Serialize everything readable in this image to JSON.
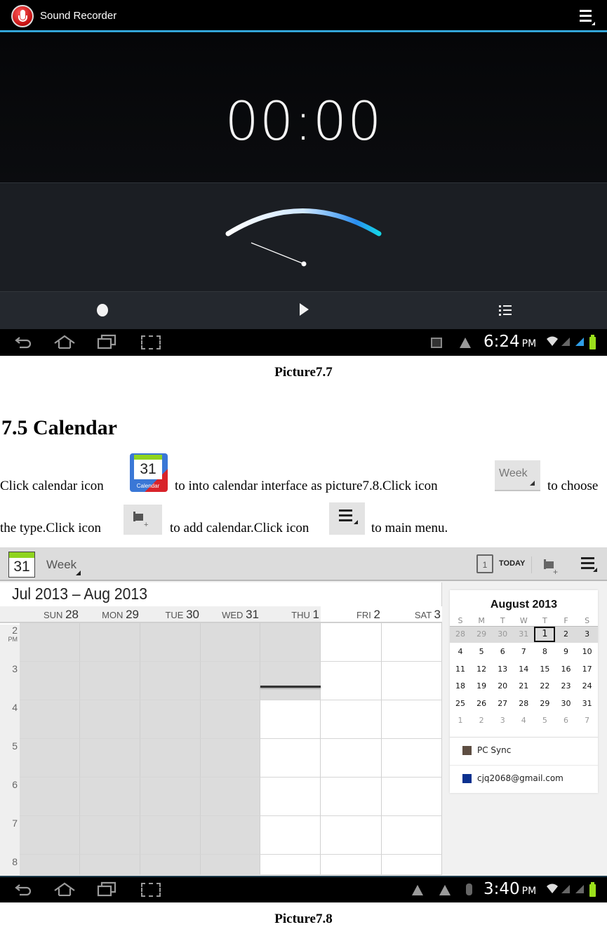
{
  "sound_recorder": {
    "app_title": "Sound Recorder",
    "timer": "00:00",
    "level_meter_value": 0,
    "controls": [
      {
        "name": "record",
        "icon": "record-icon"
      },
      {
        "name": "play",
        "icon": "play-icon"
      },
      {
        "name": "recordings-list",
        "icon": "list-icon"
      }
    ],
    "status_bar": {
      "time": "6:24",
      "ampm": "PM",
      "icons": [
        "gallery-notification-icon",
        "warning-icon",
        "wifi-icon",
        "signal-icon",
        "signal-icon",
        "battery-icon"
      ]
    }
  },
  "document": {
    "caption_1": "Picture7.7",
    "section_heading": "7.5 Calendar",
    "paragraph": {
      "part_1": "Click calendar icon",
      "part_2": "to into calendar interface as picture7.8.Click icon",
      "part_3": "to choose",
      "part_4": "the type.Click icon",
      "part_5": "to add calendar.Click icon",
      "part_6": "to main menu."
    },
    "inline_icons": {
      "calendar_app_number": "31",
      "calendar_app_label": "Calendar",
      "week_label": "Week"
    },
    "caption_2": "Picture7.8"
  },
  "calendar": {
    "app_icon_number": "31",
    "view_selector": "Week",
    "today_icon_number": "1",
    "today_label": "TODAY",
    "range_title": "Jul 2013 – Aug 2013",
    "days": [
      {
        "dow": "SUN",
        "date": "28"
      },
      {
        "dow": "MON",
        "date": "29"
      },
      {
        "dow": "TUE",
        "date": "30"
      },
      {
        "dow": "WED",
        "date": "31"
      },
      {
        "dow": "THU",
        "date": "1"
      },
      {
        "dow": "FRI",
        "date": "2"
      },
      {
        "dow": "SAT",
        "date": "3"
      }
    ],
    "hours": [
      {
        "h": "2",
        "ampm": "PM"
      },
      {
        "h": "3",
        "ampm": ""
      },
      {
        "h": "4",
        "ampm": ""
      },
      {
        "h": "5",
        "ampm": ""
      },
      {
        "h": "6",
        "ampm": ""
      },
      {
        "h": "7",
        "ampm": ""
      },
      {
        "h": "8",
        "ampm": ""
      }
    ],
    "mini_month": {
      "title": "August 2013",
      "dow": [
        "S",
        "M",
        "T",
        "W",
        "T",
        "F",
        "S"
      ],
      "weeks": [
        [
          "28",
          "29",
          "30",
          "31",
          "1",
          "2",
          "3"
        ],
        [
          "4",
          "5",
          "6",
          "7",
          "8",
          "9",
          "10"
        ],
        [
          "11",
          "12",
          "13",
          "14",
          "15",
          "16",
          "17"
        ],
        [
          "18",
          "19",
          "20",
          "21",
          "22",
          "23",
          "24"
        ],
        [
          "25",
          "26",
          "27",
          "28",
          "29",
          "30",
          "31"
        ],
        [
          "1",
          "2",
          "3",
          "4",
          "5",
          "6",
          "7"
        ]
      ],
      "selected_day": "1"
    },
    "calendars": [
      {
        "name": "PC Sync",
        "color": "#5e4e42"
      },
      {
        "name": "cjq2068@gmail.com",
        "color": "#0b318f"
      }
    ],
    "status_bar": {
      "time": "3:40",
      "ampm": "PM",
      "icons": [
        "warning-icon",
        "warning-icon",
        "bluetooth-icon",
        "wifi-icon",
        "signal-icon",
        "signal-icon",
        "battery-icon"
      ]
    }
  }
}
